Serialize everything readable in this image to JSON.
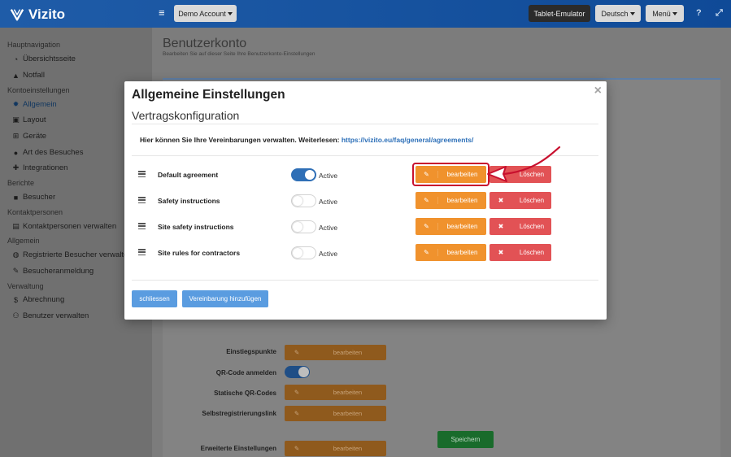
{
  "app": {
    "brand": "Vizito"
  },
  "topbar": {
    "account_label": "Demo Account",
    "tablet_label": "Tablet-Emulator",
    "language_label": "Deutsch",
    "menu_label": "Menü",
    "help_icon": "question-icon",
    "expand_icon": "expand-icon"
  },
  "sidebar": {
    "sections": [
      {
        "title": "Hauptnavigation",
        "items": [
          {
            "label": "Übersichtsseite",
            "icon": "dashboard-icon"
          },
          {
            "label": "Notfall",
            "icon": "warning-icon"
          }
        ]
      },
      {
        "title": "Kontoeinstellungen",
        "items": [
          {
            "label": "Allgemein",
            "icon": "gear-icon",
            "active": true
          },
          {
            "label": "Layout",
            "icon": "image-icon"
          },
          {
            "label": "Geräte",
            "icon": "sitemap-icon"
          },
          {
            "label": "Art des Besuches",
            "icon": "users-icon"
          },
          {
            "label": "Integrationen",
            "icon": "puzzle-icon"
          }
        ]
      },
      {
        "title": "Berichte",
        "items": [
          {
            "label": "Besucher",
            "icon": "book-icon"
          }
        ]
      },
      {
        "title": "Kontaktpersonen",
        "items": [
          {
            "label": "Kontaktpersonen verwalten",
            "icon": "address-book-icon"
          }
        ]
      },
      {
        "title": "Allgemein",
        "items": [
          {
            "label": "Registrierte Besucher verwalten",
            "icon": "globe-icon"
          },
          {
            "label": "Besucheranmeldung",
            "icon": "pencil-icon"
          }
        ]
      },
      {
        "title": "Verwaltung",
        "items": [
          {
            "label": "Abrechnung",
            "icon": "dollar-icon"
          },
          {
            "label": "Benutzer verwalten",
            "icon": "user-plus-icon"
          }
        ]
      }
    ]
  },
  "page": {
    "title": "Benutzerkonto",
    "subtitle": "Bearbeiten Sie auf dieser Seite Ihre Benutzerkonto-Einstellungen",
    "rows": [
      {
        "label": "Einstiegspunkte",
        "button": "bearbeiten"
      },
      {
        "label": "QR-Code anmelden",
        "toggle": true
      },
      {
        "label": "Statische QR-Codes",
        "button": "bearbeiten"
      },
      {
        "label": "Selbstregistrierungslink",
        "button": "bearbeiten"
      },
      {
        "label": "Erweiterte Einstellungen",
        "button": "bearbeiten"
      }
    ],
    "save_label": "Speichern"
  },
  "modal": {
    "title": "Allgemeine Einstellungen",
    "close_symbol": "×",
    "subtitle": "Vertragskonfiguration",
    "info_text": "Hier können Sie Ihre Vereinbarungen verwalten. Weiterlesen: ",
    "info_link": "https://vizito.eu/faq/general/agreements/",
    "edit_label": "bearbeiten",
    "delete_label": "Löschen",
    "agreements": [
      {
        "name": "Default agreement",
        "status": "Active",
        "enabled": true
      },
      {
        "name": "Safety instructions",
        "status": "Active",
        "enabled": false
      },
      {
        "name": "Site safety instructions",
        "status": "Active",
        "enabled": false
      },
      {
        "name": "Site rules for contractors",
        "status": "Active",
        "enabled": false
      }
    ],
    "close_button": "schliessen",
    "add_button": "Vereinbarung hinzufügen"
  },
  "colors": {
    "accent": "#2f6fb6",
    "edit": "#f0922d",
    "delete": "#e25255",
    "highlight": "#c8102e",
    "primary_button": "#5a9ce0"
  }
}
